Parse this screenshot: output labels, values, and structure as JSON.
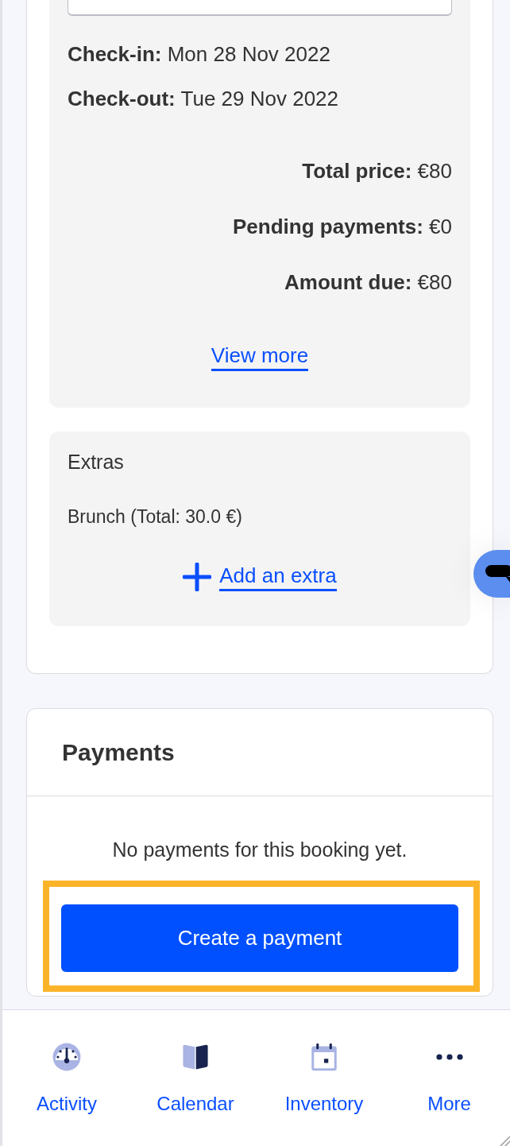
{
  "stay": {
    "lines": [
      "**Check-in:** Mon 28 Nov 2022",
      "**Check-out:** Tue 29 Nov 2022"
    ]
  },
  "totals": [
    "**Total price:** €80",
    "**Pending payments:** €0",
    "**Amount due:** €80"
  ],
  "view_more": "View more",
  "extras": {
    "title": "Extras",
    "items": [
      "Brunch (Total: 30.0 €)"
    ],
    "add_link": "Add an extra"
  },
  "payments": {
    "title": "Payments",
    "empty_message": "No payments for this booking yet.",
    "create_button": "Create a payment"
  },
  "bottom_nav": [
    {
      "label": "Activity"
    },
    {
      "label": "Calendar"
    },
    {
      "label": "Inventory"
    },
    {
      "label": "More"
    }
  ]
}
